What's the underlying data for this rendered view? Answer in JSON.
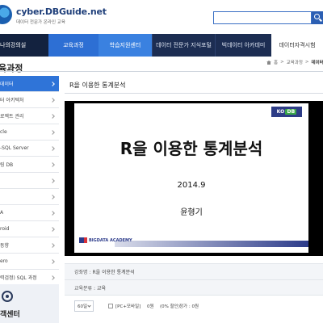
{
  "header": {
    "site_name": "cyber.DBGuide.net",
    "tagline": "데이터 전문가 온라인 교육",
    "search": {
      "placeholder": ""
    }
  },
  "nav": {
    "items": [
      {
        "label": "나의강의실"
      },
      {
        "label": "교육과정"
      },
      {
        "label": "학습지원센터"
      },
      {
        "label": "데이터 전문가 지식포털"
      },
      {
        "label": "빅데이터 아카데미"
      },
      {
        "label": "데이터자격시험"
      }
    ]
  },
  "section": {
    "title": "육과정",
    "breadcrumb": [
      "홈",
      "교육과정",
      "데이터 분석"
    ]
  },
  "sidebar": {
    "items": [
      {
        "label": "데이터",
        "active": true
      },
      {
        "label": "터 아키텍처",
        "active": false
      },
      {
        "label": "로젝트 관리",
        "active": false
      },
      {
        "label": "cle",
        "active": false
      },
      {
        "label": "-SQL Server",
        "active": false
      },
      {
        "label": "링 DB",
        "active": false
      },
      {
        "label": "",
        "active": false
      },
      {
        "label": "",
        "active": false
      },
      {
        "label": "A",
        "active": false
      },
      {
        "label": "roid",
        "active": false
      },
      {
        "label": "동향",
        "active": false
      },
      {
        "label": "ero",
        "active": false
      },
      {
        "label": "력검정) SQL 과정",
        "active": false
      }
    ],
    "customer_center": "객센터"
  },
  "main": {
    "title": "R을 이용한 통계분석",
    "slide": {
      "logo_left": "KO",
      "logo_right": "DB",
      "title": "R을 이용한 통계분석",
      "date": "2014.9",
      "author": "윤형기",
      "footer_logo": "BIGDATA ACADEMY"
    },
    "course_name": {
      "label": "강좌명 :",
      "value": "R을 이용한 통계분석"
    },
    "category": {
      "label": "교육분류 :",
      "value": "교육"
    },
    "options": {
      "period_select": "60일",
      "option_label": "[PC+모바일]",
      "price": "0원",
      "discount": "(0% 할인)",
      "total": "정가 : 0원"
    }
  }
}
